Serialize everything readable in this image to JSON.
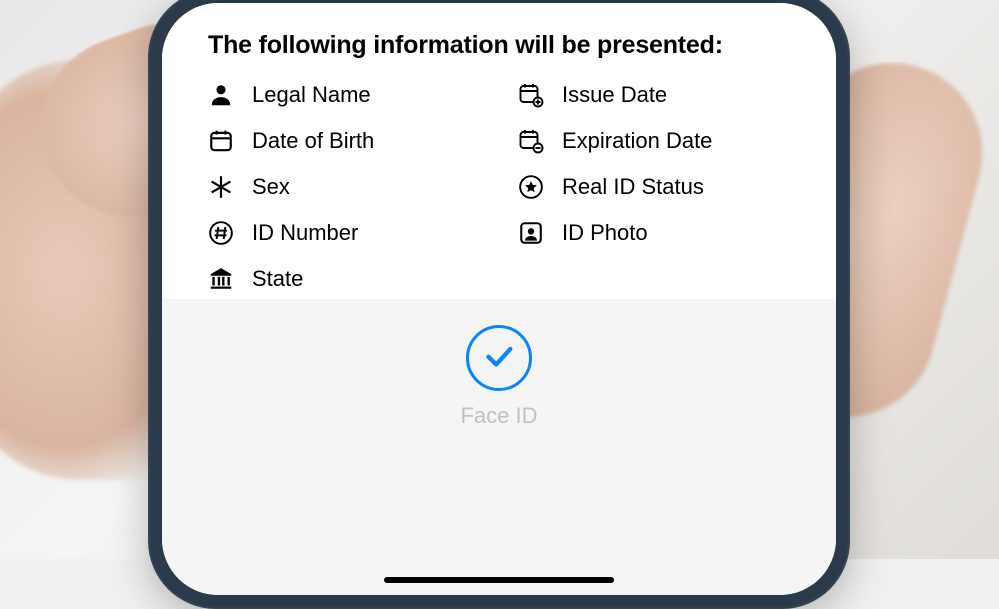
{
  "title": "The following information will be presented:",
  "left": [
    {
      "icon": "person-icon",
      "label": "Legal Name"
    },
    {
      "icon": "calendar-icon",
      "label": "Date of Birth"
    },
    {
      "icon": "asterisk-icon",
      "label": "Sex"
    },
    {
      "icon": "hash-circle-icon",
      "label": "ID Number"
    },
    {
      "icon": "institution-icon",
      "label": "State"
    }
  ],
  "right": [
    {
      "icon": "calendar-plus-icon",
      "label": "Issue Date"
    },
    {
      "icon": "calendar-minus-icon",
      "label": "Expiration Date"
    },
    {
      "icon": "star-circle-icon",
      "label": "Real ID Status"
    },
    {
      "icon": "photo-id-icon",
      "label": "ID Photo"
    }
  ],
  "faceid_label": "Face ID",
  "colors": {
    "accent": "#0a84ff"
  }
}
